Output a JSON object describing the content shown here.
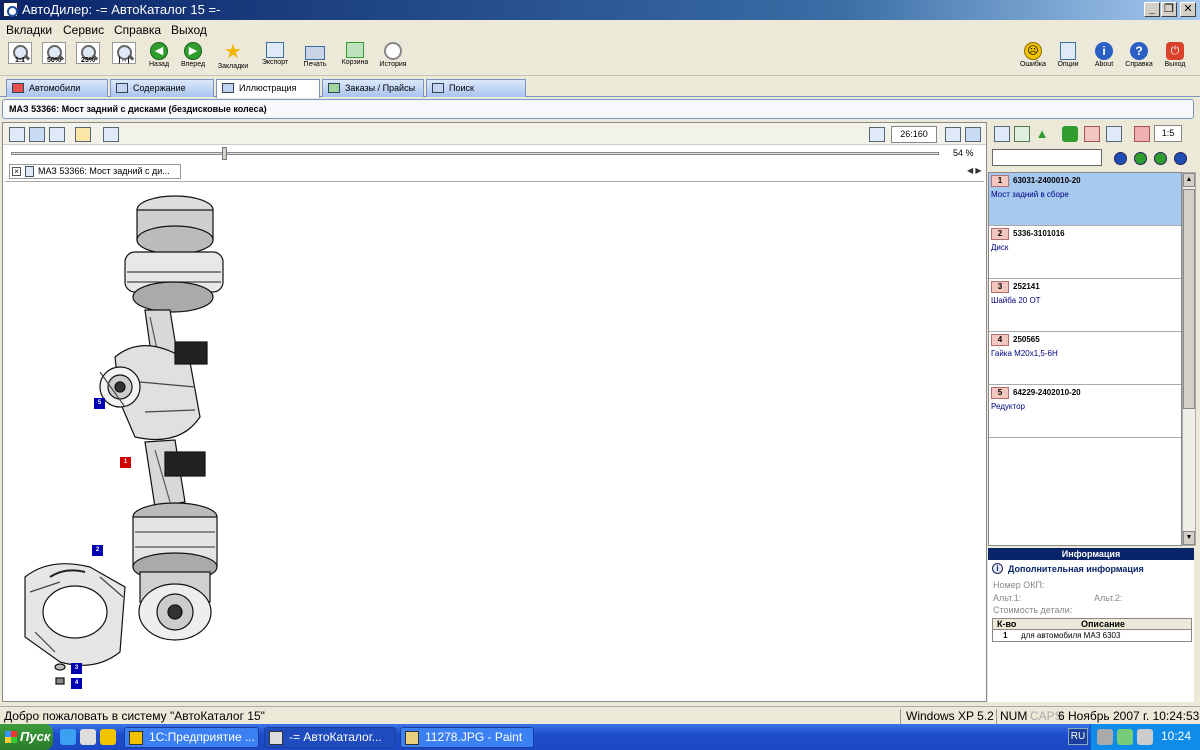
{
  "window": {
    "title": "АвтоДилер: -= АвтоКаталог 15 =-",
    "minimize_icon": "minimize-icon",
    "restore_icon": "restore-icon",
    "close_icon": "close-icon"
  },
  "menu": [
    "Вкладки",
    "Сервис",
    "Справка",
    "Выход"
  ],
  "toolbar": {
    "zoom": [
      {
        "label": "1:1",
        "icon": "zoom-1-1-icon"
      },
      {
        "label": "50%",
        "icon": "zoom-50-icon"
      },
      {
        "label": "25%",
        "icon": "zoom-25-icon"
      },
      {
        "label": "",
        "icon": "zoom-fit-width-icon"
      }
    ],
    "actions": [
      {
        "label": "Назад",
        "icon": "back-arrow-icon",
        "color": "#2f9e2f"
      },
      {
        "label": "Вперед",
        "icon": "forward-arrow-icon",
        "color": "#2f9e2f"
      },
      {
        "label": "Закладки",
        "icon": "star-icon",
        "color": "#f2b400"
      },
      {
        "label": "Экспорт",
        "icon": "export-icon",
        "color": "#3a6ea5"
      },
      {
        "label": "Печать",
        "icon": "printer-icon",
        "color": "#3a6ea5"
      },
      {
        "label": "Корзина",
        "icon": "basket-icon",
        "color": "#2f9e2f"
      },
      {
        "label": "История",
        "icon": "history-icon",
        "color": "#cc3333"
      }
    ],
    "right_actions": [
      {
        "label": "Ошибка",
        "icon": "smiley-error-icon",
        "color": "#f2c400"
      },
      {
        "label": "Опции",
        "icon": "options-icon",
        "color": "#3a6ea5"
      },
      {
        "label": "About",
        "icon": "info-icon",
        "color": "#2a5fc4"
      },
      {
        "label": "Справка",
        "icon": "help-icon",
        "color": "#2a5fc4"
      },
      {
        "label": "Выход",
        "icon": "exit-icon",
        "color": "#d9412b"
      }
    ]
  },
  "tabs": [
    {
      "label": "Автомобили",
      "icon": "car-icon",
      "active": false
    },
    {
      "label": "Содержание",
      "icon": "contents-icon",
      "active": false
    },
    {
      "label": "Иллюстрация",
      "icon": "illustration-icon",
      "active": true
    },
    {
      "label": "Заказы / Прайсы",
      "icon": "orders-icon",
      "active": false
    },
    {
      "label": "Поиск",
      "icon": "search-icon",
      "active": false
    }
  ],
  "path": "МАЗ 53366: Мост задний с дисками (бездисковые колеса)",
  "viewer": {
    "ratio": "26:160",
    "zoom_percent": "54 %",
    "zoom_value": 0.23,
    "doc_tab": "МАЗ 53366: Мост задний с ди...",
    "callouts": [
      {
        "n": "5",
        "color": "blue"
      },
      {
        "n": "1",
        "color": "red"
      },
      {
        "n": "2",
        "color": "blue"
      },
      {
        "n": "3",
        "color": "blue"
      },
      {
        "n": "4",
        "color": "blue"
      }
    ]
  },
  "right": {
    "scale": "1:5",
    "search_value": "",
    "parts": [
      {
        "num": "1",
        "code": "63031-2400010-20",
        "desc": "Мост задний в сборе",
        "selected": true
      },
      {
        "num": "2",
        "code": "5336-3101016",
        "desc": "Диск",
        "selected": false
      },
      {
        "num": "3",
        "code": "252141",
        "desc": "Шайба 20 ОТ",
        "selected": false
      },
      {
        "num": "4",
        "code": "250565",
        "desc": "Гайка М20х1,5-6Н",
        "selected": false
      },
      {
        "num": "5",
        "code": "64229-2402010-20",
        "desc": "Редуктор",
        "selected": false
      }
    ],
    "info": {
      "header": "Информация",
      "additional": "Дополнительная информация",
      "okp_label": "Номер ОКП:",
      "alt1_label": "Альт.1:",
      "alt2_label": "Альт.2:",
      "cost_label": "Стоимость детали:",
      "grid_headers": [
        "К-во",
        "Описание"
      ],
      "grid_rows": [
        {
          "qty": "1",
          "desc": "для автомобиля МАЗ 6303"
        }
      ]
    }
  },
  "status": {
    "welcome": "Добро пожаловать в систему \"АвтоКаталог 15\"",
    "os": "Windows XP 5.2",
    "num": "NUM",
    "caps": "CAPS",
    "datetime": "6 Ноябрь 2007 г. 10:24:53"
  },
  "taskbar": {
    "start": "Пуск",
    "tasks": [
      {
        "label": "1С:Предприятие ...",
        "active": false
      },
      {
        "label": "-= АвтоКаталог...",
        "active": true
      },
      {
        "label": "11278.JPG - Paint",
        "active": false
      }
    ],
    "lang": "RU",
    "time": "10:24"
  }
}
